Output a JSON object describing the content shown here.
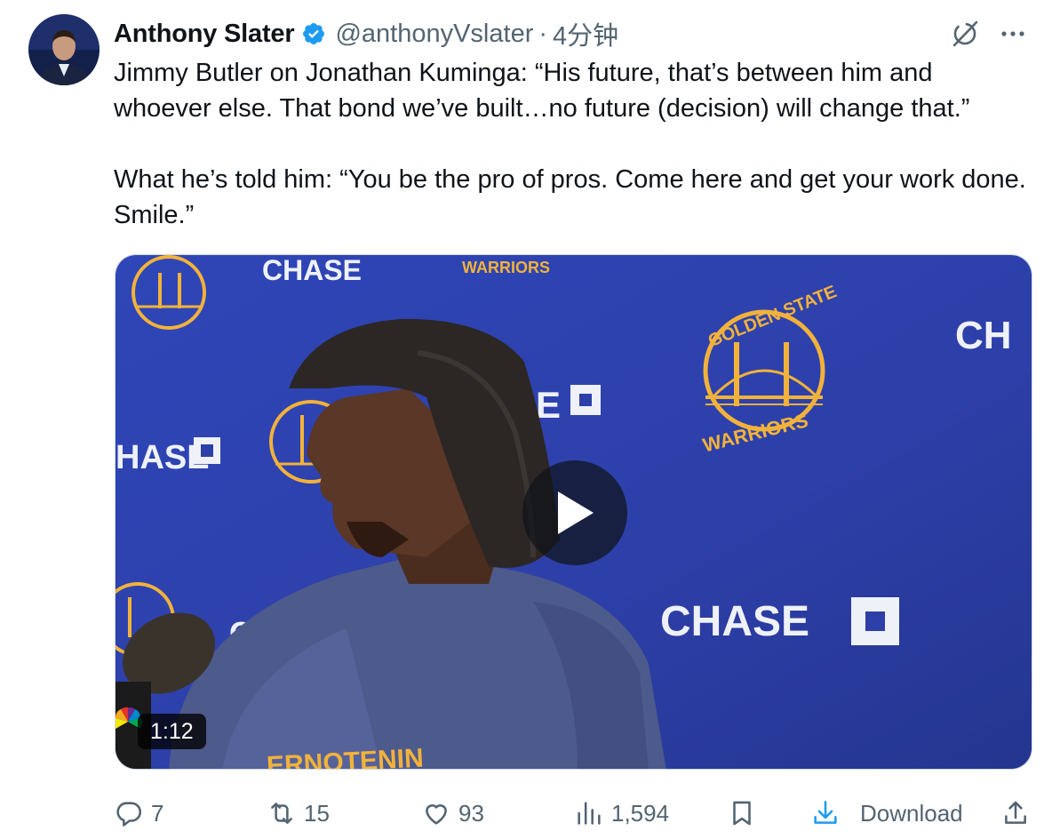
{
  "tweet": {
    "author_name": "Anthony Slater",
    "handle": "@anthonyVslater",
    "separator": "·",
    "time": "4分钟",
    "paragraphs": [
      "Jimmy Butler on Jonathan Kuminga: “His future, that’s between him and whoever else. That bond we’ve built…no future (decision) will change that.”",
      "What he’s told him: “You be the pro of pros. Come here and get your work done. Smile.”"
    ]
  },
  "media": {
    "duration": "1:12",
    "backdrop_text": {
      "chase": "CHASE",
      "chase_partial_1": "CHASE",
      "chase_partial_2": "CH",
      "chase_partial_3": "SE",
      "chase_partial_4": "HASE",
      "chase_partial_5": "CI",
      "golden_state": "GOLDEN STATE",
      "warriors": "WARRIORS",
      "shirt_text": "ERNOTENIN"
    },
    "colors": {
      "backdrop_blue": "#2d3fa8",
      "warriors_gold": "#f2b23a",
      "sweatshirt": "#4d5a8c",
      "play_overlay": "#0f1419"
    }
  },
  "actions": {
    "reply": {
      "count": "7",
      "icon": "reply-icon"
    },
    "repost": {
      "count": "15",
      "icon": "repost-icon"
    },
    "like": {
      "count": "93",
      "icon": "heart-icon"
    },
    "views": {
      "count": "1,594",
      "icon": "bar-chart-icon"
    },
    "bookmark": {
      "icon": "bookmark-icon"
    },
    "download": {
      "label": "Download",
      "icon": "download-icon",
      "color": "#1d9bf0"
    },
    "share": {
      "icon": "share-icon"
    }
  },
  "colors": {
    "text_primary": "#0f1419",
    "text_secondary": "#536471",
    "verified_blue": "#1d9bf0"
  }
}
